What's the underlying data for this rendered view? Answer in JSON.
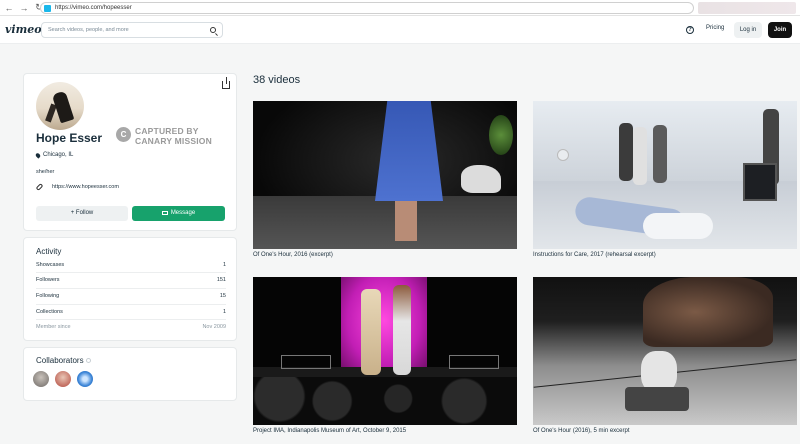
{
  "browser": {
    "url": "https://vimeo.com/hopeesser",
    "back": "←",
    "forward": "→",
    "reload": "↻"
  },
  "header": {
    "logo": "vimeo",
    "search_placeholder": "Search videos, people, and more",
    "help": "?",
    "pricing": "Pricing",
    "login": "Log in",
    "join": "Join"
  },
  "profile": {
    "name": "Hope Esser",
    "location": "Chicago, IL",
    "pronouns": "she/her",
    "website": "https://www.hopeesser.com",
    "follow_label": "Follow",
    "follow_prefix": "+",
    "message_label": "Message"
  },
  "watermark": {
    "line1": "CAPTURED BY",
    "line2": "CANARY MISSION",
    "seal_letter": "C"
  },
  "activity": {
    "title": "Activity",
    "rows": [
      {
        "label": "Showcases",
        "value": "1"
      },
      {
        "label": "Followers",
        "value": "151"
      },
      {
        "label": "Following",
        "value": "15"
      },
      {
        "label": "Collections",
        "value": "1"
      },
      {
        "label": "Member since",
        "value": "Nov 2009"
      }
    ]
  },
  "collaborators": {
    "title": "Collaborators",
    "avatar_colors": [
      "#8c8c8c",
      "#c45a4a",
      "#4a8fd6"
    ]
  },
  "videos": {
    "title": "38 videos",
    "items": [
      {
        "caption": "Of One's Hour, 2016 (excerpt)"
      },
      {
        "caption": "Instructions for Care, 2017 (rehearsal excerpt)"
      },
      {
        "caption": "Project IMA, Indianapolis Museum of Art, October 9, 2015"
      },
      {
        "caption": "Of One's Hour (2016), 5 min excerpt"
      }
    ]
  },
  "colors": {
    "accent_green": "#17a26c",
    "join_black": "#111111",
    "text": "#1a2e3b"
  }
}
